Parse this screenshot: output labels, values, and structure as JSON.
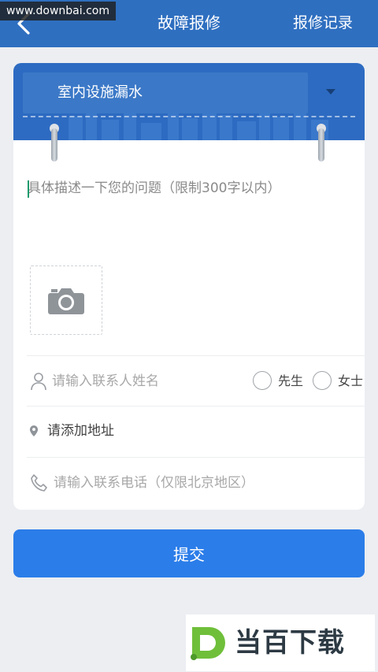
{
  "watermark": {
    "site": "www.downbai.com",
    "brand": "当百下载"
  },
  "header": {
    "title": "故障报修",
    "records_label": "报修记录"
  },
  "form": {
    "category_selected": "室内设施漏水",
    "description_placeholder": "具体描述一下您的问题（限制300字以内）",
    "name_placeholder": "请输入联系人姓名",
    "gender_options": [
      "先生",
      "女士"
    ],
    "address_label": "请添加地址",
    "phone_placeholder": "请输入联系电话（仅限北京地区）"
  },
  "submit_label": "提交",
  "colors": {
    "header_bg": "#2f6fc0",
    "accent": "#2b7de9",
    "banner": "#2d6bc2",
    "page_bg": "#eceef2"
  },
  "icons": [
    "back-arrow-icon",
    "dropdown-caret-icon",
    "camera-icon",
    "person-icon",
    "location-pin-icon",
    "phone-icon",
    "downbai-logo"
  ]
}
